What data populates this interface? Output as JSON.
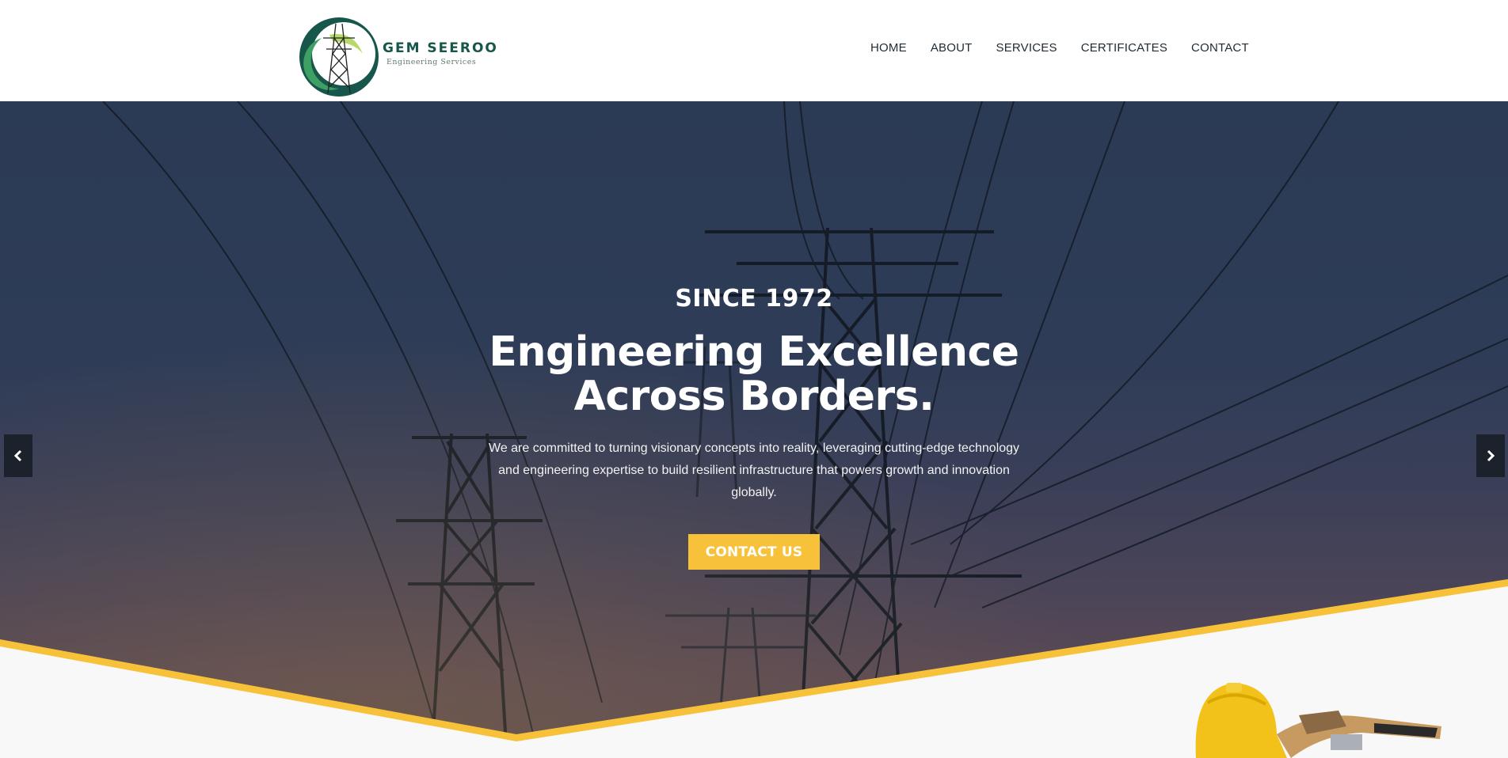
{
  "brand": {
    "name": "GEM SEEROO",
    "tagline": "Engineering Services",
    "colors": {
      "dark_green": "#17564a",
      "green": "#3fa064",
      "light_green": "#b7d96a"
    }
  },
  "nav": {
    "items": [
      {
        "label": "HOME"
      },
      {
        "label": "ABOUT"
      },
      {
        "label": "SERVICES"
      },
      {
        "label": "CERTIFICATES"
      },
      {
        "label": "CONTACT"
      }
    ]
  },
  "hero": {
    "kicker": "SINCE 1972",
    "title_line1": "Engineering Excellence",
    "title_line2": "Across Borders.",
    "description": "We are committed to turning visionary concepts into reality, leveraging cutting-edge technology and engineering expertise to build resilient infrastructure that powers growth and innovation globally.",
    "cta_label": "CONTACT US",
    "accent_color": "#f7c23a",
    "prev_icon": "chevron-left-icon",
    "next_icon": "chevron-right-icon"
  }
}
